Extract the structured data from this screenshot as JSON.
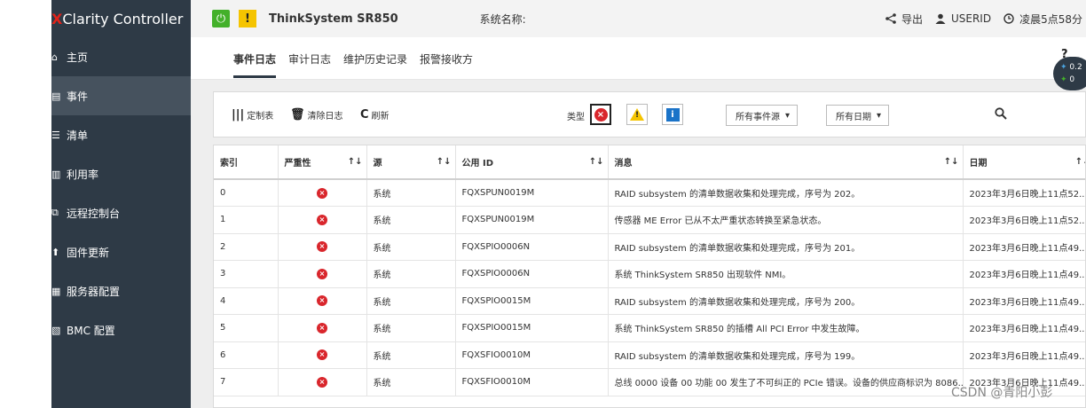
{
  "sidebar": {
    "brand_x": "X",
    "brand_rest": "Clarity Controller",
    "items": [
      {
        "icon": "⌂",
        "label": "主页"
      },
      {
        "icon": "▤",
        "label": "事件"
      },
      {
        "icon": "☰",
        "label": "清单"
      },
      {
        "icon": "▥",
        "label": "利用率"
      },
      {
        "icon": "⧉",
        "label": "远程控制台"
      },
      {
        "icon": "⬆",
        "label": "固件更新"
      },
      {
        "icon": "▦",
        "label": "服务器配置"
      },
      {
        "icon": "▧",
        "label": "BMC 配置"
      }
    ]
  },
  "header": {
    "power_icon": "⏻",
    "warning_icon": "!",
    "model": "ThinkSystem SR850",
    "system_name_label": "系统名称:",
    "export_label": "导出",
    "user_label": "USERID",
    "time_label": "凌晨5点58分"
  },
  "tabs": [
    "事件日志",
    "审计日志",
    "维护历史记录",
    "报警接收方"
  ],
  "toolbar": {
    "customize_label": "定制表",
    "clear_label": "清除日志",
    "refresh_label": "刷新",
    "type_label": "类型",
    "source_filter": "所有事件源",
    "date_filter": "所有日期"
  },
  "table": {
    "columns": [
      "索引",
      "严重性",
      "源",
      "公用 ID",
      "消息",
      "日期"
    ],
    "sort_icon": "↑↓",
    "rows": [
      {
        "index": "0",
        "source": "系统",
        "id": "FQXSPUN0019M",
        "message": "RAID subsystem 的清单数据收集和处理完成，序号为 202。",
        "date": "2023年3月6日晚上11点52..."
      },
      {
        "index": "1",
        "source": "系统",
        "id": "FQXSPUN0019M",
        "message": "传感器 ME Error 已从不太严重状态转换至紧急状态。",
        "date": "2023年3月6日晚上11点52..."
      },
      {
        "index": "2",
        "source": "系统",
        "id": "FQXSPIO0006N",
        "message": "RAID subsystem 的清单数据收集和处理完成，序号为 201。",
        "date": "2023年3月6日晚上11点49..."
      },
      {
        "index": "3",
        "source": "系统",
        "id": "FQXSPIO0006N",
        "message": "系统 ThinkSystem SR850 出现软件 NMI。",
        "date": "2023年3月6日晚上11点49..."
      },
      {
        "index": "4",
        "source": "系统",
        "id": "FQXSPIO0015M",
        "message": "RAID subsystem 的清单数据收集和处理完成，序号为 200。",
        "date": "2023年3月6日晚上11点49..."
      },
      {
        "index": "5",
        "source": "系统",
        "id": "FQXSPIO0015M",
        "message": "系统 ThinkSystem SR850 的插槽 All PCI Error 中发生故障。",
        "date": "2023年3月6日晚上11点49..."
      },
      {
        "index": "6",
        "source": "系统",
        "id": "FQXSFIO0010M",
        "message": "RAID subsystem 的清单数据收集和处理完成，序号为 199。",
        "date": "2023年3月6日晚上11点49..."
      },
      {
        "index": "7",
        "source": "系统",
        "id": "FQXSFIO0010M",
        "message": "总线 0000 设备 00 功能 00 发生了不可纠正的 PCIe 错误。设备的供应商标识为 8086...",
        "date": "2023年3月6日晚上11点49..."
      }
    ]
  },
  "fab": {
    "line1": "0.2",
    "line2": "0"
  },
  "watermark": "CSDN @青阳小彭",
  "colors": {
    "sidebar": "#2e3a46",
    "power": "#43b02a",
    "warning": "#f5c400",
    "error": "#d9262c",
    "info": "#1a73c8"
  }
}
